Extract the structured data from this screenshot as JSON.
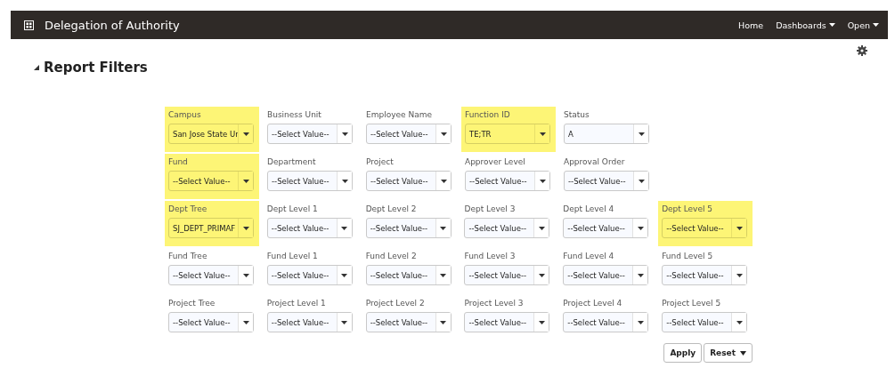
{
  "header": {
    "title": "Delegation of Authority",
    "nav": [
      {
        "label": "Home",
        "menu": false
      },
      {
        "label": "Dashboards",
        "menu": true
      },
      {
        "label": "Open",
        "menu": true
      }
    ]
  },
  "section": {
    "title": "Report Filters",
    "expanded": true
  },
  "filter_rows": [
    [
      {
        "label": "Campus",
        "value": "San Jose State Ur",
        "highlighted": true
      },
      {
        "label": "Business Unit",
        "value": "--Select Value--",
        "highlighted": false
      },
      {
        "label": "Employee Name",
        "value": "--Select Value--",
        "highlighted": false
      },
      {
        "label": "Function ID",
        "value": "TE;TR",
        "highlighted": true
      },
      {
        "label": "Status",
        "value": "A",
        "highlighted": false
      }
    ],
    [
      {
        "label": "Fund",
        "value": "--Select Value--",
        "highlighted": true
      },
      {
        "label": "Department",
        "value": "--Select Value--",
        "highlighted": false
      },
      {
        "label": "Project",
        "value": "--Select Value--",
        "highlighted": false
      },
      {
        "label": "Approver Level",
        "value": "--Select Value--",
        "highlighted": false
      },
      {
        "label": "Approval Order",
        "value": "--Select Value--",
        "highlighted": false
      }
    ],
    [
      {
        "label": "Dept Tree",
        "value": "SJ_DEPT_PRIMAF",
        "highlighted": true
      },
      {
        "label": "Dept Level 1",
        "value": "--Select Value--",
        "highlighted": false
      },
      {
        "label": "Dept Level 2",
        "value": "--Select Value--",
        "highlighted": false
      },
      {
        "label": "Dept Level 3",
        "value": "--Select Value--",
        "highlighted": false
      },
      {
        "label": "Dept Level 4",
        "value": "--Select Value--",
        "highlighted": false
      },
      {
        "label": "Dept Level 5",
        "value": "--Select Value--",
        "highlighted": true
      }
    ],
    [
      {
        "label": "Fund Tree",
        "value": "--Select Value--",
        "highlighted": false
      },
      {
        "label": "Fund Level 1",
        "value": "--Select Value--",
        "highlighted": false
      },
      {
        "label": "Fund Level 2",
        "value": "--Select Value--",
        "highlighted": false
      },
      {
        "label": "Fund Level 3",
        "value": "--Select Value--",
        "highlighted": false
      },
      {
        "label": "Fund Level 4",
        "value": "--Select Value--",
        "highlighted": false
      },
      {
        "label": "Fund Level 5",
        "value": "--Select Value--",
        "highlighted": false
      }
    ],
    [
      {
        "label": "Project Tree",
        "value": "--Select Value--",
        "highlighted": false
      },
      {
        "label": "Project Level 1",
        "value": "--Select Value--",
        "highlighted": false
      },
      {
        "label": "Project Level 2",
        "value": "--Select Value--",
        "highlighted": false
      },
      {
        "label": "Project Level 3",
        "value": "--Select Value--",
        "highlighted": false
      },
      {
        "label": "Project Level 4",
        "value": "--Select Value--",
        "highlighted": false
      },
      {
        "label": "Project Level 5",
        "value": "--Select Value--",
        "highlighted": false
      }
    ]
  ],
  "buttons": [
    {
      "label": "Apply",
      "menu": false
    },
    {
      "label": "Reset",
      "menu": true
    }
  ]
}
